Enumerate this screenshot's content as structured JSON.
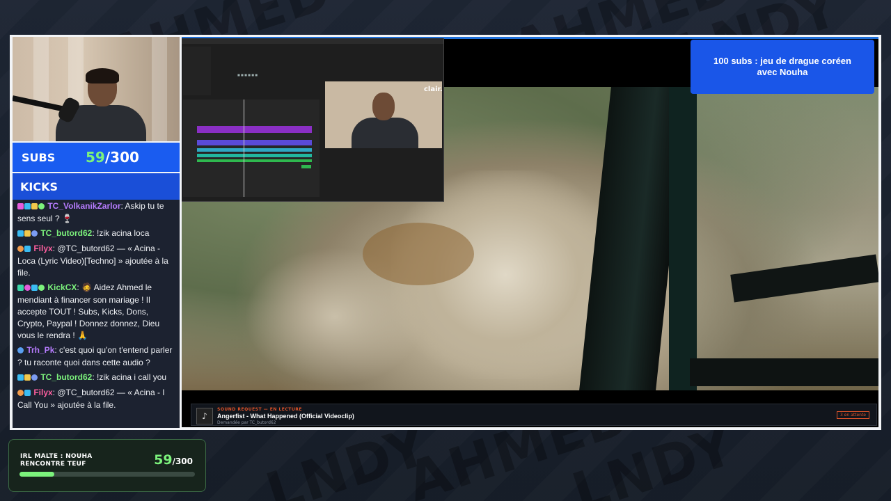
{
  "overlay": {
    "subs": {
      "label": "SUBS",
      "current": "59",
      "separator_total": "/300"
    },
    "kicks": {
      "label": "KICKS"
    },
    "goal_banner": "100 subs : jeu de drague coréen avec Nouha",
    "bottom_goal": {
      "title": "IRL MALTE : NOUHA RENCONTRE TEUF",
      "current": "59",
      "total": "/300",
      "progress": 0.197
    },
    "colors": {
      "accent_blue": "#1a5cf0",
      "green": "#7cf27c"
    }
  },
  "chat": [
    {
      "user": "TC_VolkanikZarlor",
      "user_color": "#b77cff",
      "text": ": Askip tu te sens seul ? 🍷"
    },
    {
      "user": "TC_butord62",
      "user_color": "#7cf27c",
      "text": ": !zik acina loca"
    },
    {
      "user": "Filyx",
      "user_color": "#ff5fa0",
      "text": ": @TC_butord62 — « Acina - Loca (Lyric Video)[Techno] » ajoutée à la file."
    },
    {
      "user": "KickCX",
      "user_color": "#7cf27c",
      "text": ": 🧔 Aidez Ahmed le mendiant à financer son mariage ! Il accepte TOUT ! Subs, Kicks, Dons, Crypto, Paypal ! Donnez donnez, Dieu vous le rendra ! 🙏"
    },
    {
      "user": "Trh_Pk",
      "user_color": "#b77cff",
      "text": ": c'est quoi qu'on t'entend parler ? tu raconte quoi dans cette audio ?"
    },
    {
      "user": "TC_butord62",
      "user_color": "#7cf27c",
      "text": ": !zik acina i call you"
    },
    {
      "user": "Filyx",
      "user_color": "#ff5fa0",
      "text": ": @TC_butord62 — « Acina - I Call You » ajoutée à la file."
    }
  ],
  "pip": {
    "logo": "clair."
  },
  "song_request": {
    "status": "SOUND REQUEST — EN LECTURE",
    "title": "Angerfist - What Happened (Official Videoclip)",
    "requested_by": "Demandée par TC_butord62",
    "queue": "3 en attente"
  },
  "background_watermark": [
    "AHMED",
    "LNDY"
  ]
}
